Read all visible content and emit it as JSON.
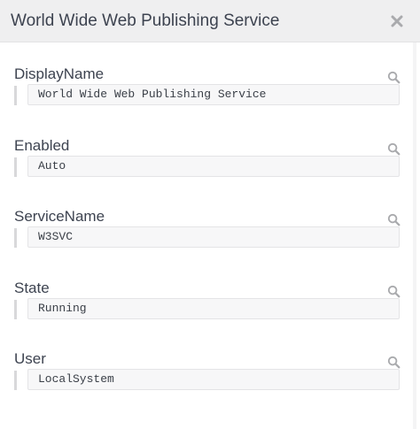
{
  "window": {
    "title": "World Wide Web Publishing Service",
    "close_icon": "close-icon"
  },
  "fields": [
    {
      "label": "DisplayName",
      "value": "World Wide Web Publishing Service",
      "icon": "search-icon"
    },
    {
      "label": "Enabled",
      "value": "Auto",
      "icon": "search-icon"
    },
    {
      "label": "ServiceName",
      "value": "W3SVC",
      "icon": "search-icon"
    },
    {
      "label": "State",
      "value": "Running",
      "icon": "search-icon"
    },
    {
      "label": "User",
      "value": "LocalSystem",
      "icon": "search-icon"
    }
  ],
  "colors": {
    "header_bg": "#efeff0",
    "icon": "#a9aaad",
    "text": "#3d4350"
  }
}
